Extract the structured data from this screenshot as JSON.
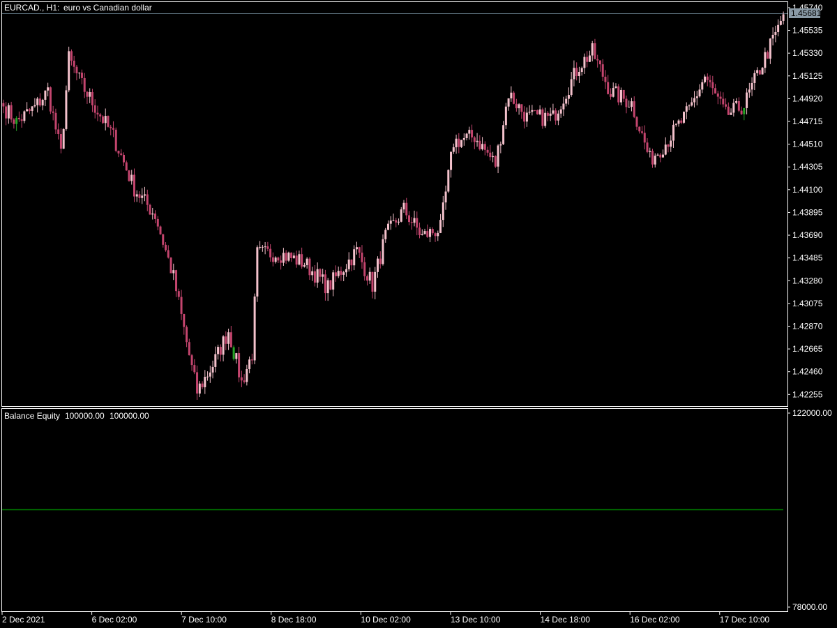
{
  "window": {
    "symbol_label": "EURCAD., H1:",
    "description": "euro vs Canadian dollar"
  },
  "colors": {
    "background": "#000000",
    "frame": "#ffffff",
    "bear_candle": "#c4456e",
    "bull_candle": "#f4c2cc",
    "green_candle": "#27a527",
    "equity_line": "#008000",
    "bid_line": "#5a6e7a",
    "price_box": "#8a9aa6"
  },
  "price_axis": {
    "current_price": "1.45681",
    "tick_labels": [
      "1.45740",
      "1.45535",
      "1.45330",
      "1.45125",
      "1.44920",
      "1.44715",
      "1.44510",
      "1.44305",
      "1.44100",
      "1.43895",
      "1.43690",
      "1.43485",
      "1.43280",
      "1.43075",
      "1.42870",
      "1.42665",
      "1.42460",
      "1.42255"
    ]
  },
  "indicator": {
    "title": "Balance Equity",
    "balance": "100000.00",
    "equity": "100000.00",
    "axis_top": "122000.00",
    "axis_bottom": "78000.00"
  },
  "time_axis": {
    "labels": [
      "2 Dec 2021",
      "6 Dec 02:00",
      "7 Dec 10:00",
      "8 Dec 18:00",
      "10 Dec 02:00",
      "13 Dec 10:00",
      "14 Dec 18:00",
      "16 Dec 02:00",
      "17 Dec 10:00"
    ]
  },
  "chart_data": [
    {
      "type": "candlestick",
      "title": "EURCAD., H1:  euro vs Canadian dollar",
      "ylim": [
        1.4215,
        1.4579
      ],
      "x_ticks": [
        "2 Dec 2021",
        "6 Dec 02:00",
        "7 Dec 10:00",
        "8 Dec 18:00",
        "10 Dec 02:00",
        "13 Dec 10:00",
        "14 Dec 18:00",
        "16 Dec 02:00",
        "17 Dec 10:00"
      ],
      "y_ticks": [
        1.4574,
        1.45535,
        1.4533,
        1.45125,
        1.4492,
        1.44715,
        1.4451,
        1.44305,
        1.441,
        1.43895,
        1.4369,
        1.43485,
        1.4328,
        1.43075,
        1.4287,
        1.42665,
        1.4246,
        1.42255
      ],
      "current_price": 1.45681,
      "series": [
        {
          "name": "EURCAD.",
          "close_keypoints": [
            {
              "bar": 0,
              "close": 1.4485
            },
            {
              "bar": 5,
              "close": 1.4471
            },
            {
              "bar": 12,
              "close": 1.4484
            },
            {
              "bar": 17,
              "close": 1.4499
            },
            {
              "bar": 22,
              "close": 1.4442
            },
            {
              "bar": 25,
              "close": 1.4528
            },
            {
              "bar": 30,
              "close": 1.4504
            },
            {
              "bar": 42,
              "close": 1.4458
            },
            {
              "bar": 50,
              "close": 1.4411
            },
            {
              "bar": 58,
              "close": 1.4387
            },
            {
              "bar": 65,
              "close": 1.4331
            },
            {
              "bar": 72,
              "close": 1.4249
            },
            {
              "bar": 74,
              "close": 1.4228
            },
            {
              "bar": 80,
              "close": 1.4252
            },
            {
              "bar": 86,
              "close": 1.4283
            },
            {
              "bar": 91,
              "close": 1.4236
            },
            {
              "bar": 95,
              "close": 1.4262
            },
            {
              "bar": 97,
              "close": 1.4352
            },
            {
              "bar": 105,
              "close": 1.4353
            },
            {
              "bar": 115,
              "close": 1.4344
            },
            {
              "bar": 124,
              "close": 1.4322
            },
            {
              "bar": 135,
              "close": 1.4355
            },
            {
              "bar": 141,
              "close": 1.4324
            },
            {
              "bar": 146,
              "close": 1.4368
            },
            {
              "bar": 153,
              "close": 1.4392
            },
            {
              "bar": 160,
              "close": 1.4368
            },
            {
              "bar": 167,
              "close": 1.4375
            },
            {
              "bar": 172,
              "close": 1.4453
            },
            {
              "bar": 180,
              "close": 1.4458
            },
            {
              "bar": 188,
              "close": 1.4433
            },
            {
              "bar": 193,
              "close": 1.4497
            },
            {
              "bar": 200,
              "close": 1.4475
            },
            {
              "bar": 210,
              "close": 1.4475
            },
            {
              "bar": 220,
              "close": 1.4522
            },
            {
              "bar": 225,
              "close": 1.4534
            },
            {
              "bar": 232,
              "close": 1.4498
            },
            {
              "bar": 240,
              "close": 1.4488
            },
            {
              "bar": 247,
              "close": 1.4437
            },
            {
              "bar": 253,
              "close": 1.4452
            },
            {
              "bar": 262,
              "close": 1.4481
            },
            {
              "bar": 268,
              "close": 1.4512
            },
            {
              "bar": 276,
              "close": 1.4477
            },
            {
              "bar": 283,
              "close": 1.4486
            },
            {
              "bar": 290,
              "close": 1.4524
            },
            {
              "bar": 296,
              "close": 1.4555
            },
            {
              "bar": 298,
              "close": 1.4568
            }
          ]
        }
      ]
    },
    {
      "type": "line",
      "title": "Balance Equity",
      "ylim": [
        78000,
        122000
      ],
      "series": [
        {
          "name": "Balance",
          "values": [
            100000,
            100000
          ]
        },
        {
          "name": "Equity",
          "values": [
            100000,
            100000
          ]
        }
      ]
    }
  ]
}
